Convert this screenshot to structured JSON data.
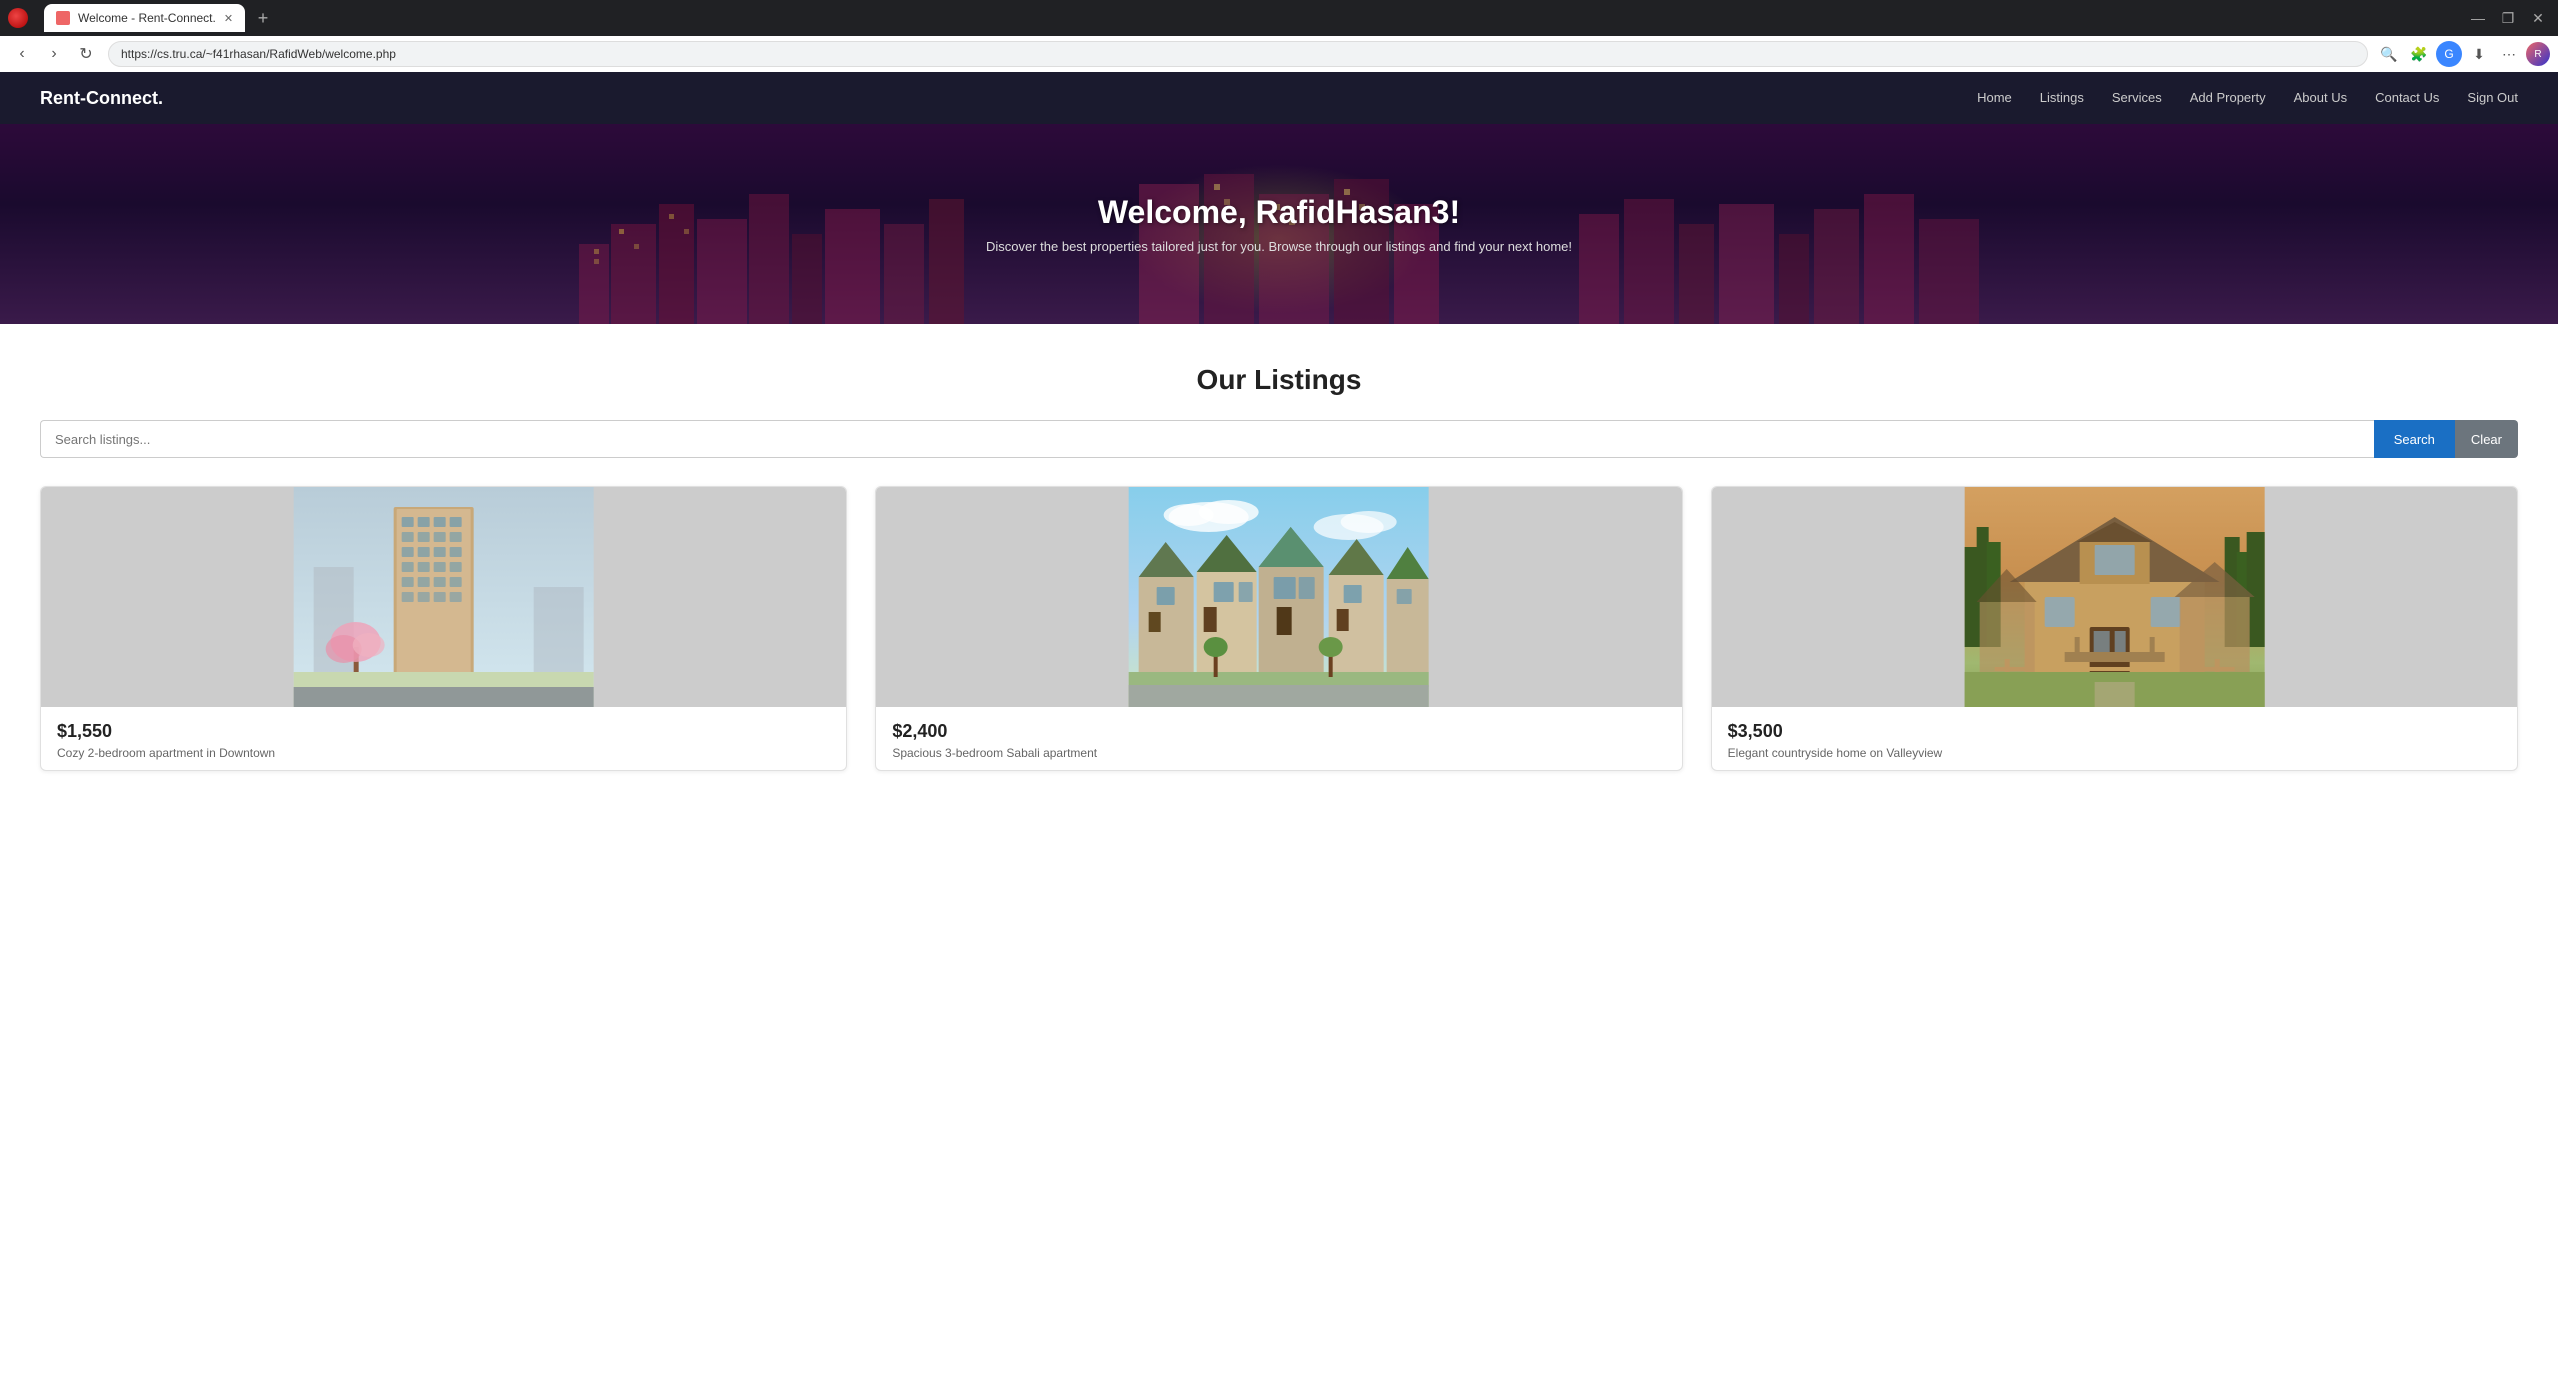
{
  "browser": {
    "tab_title": "Welcome - Rent-Connect.",
    "url": "https://cs.tru.ca/~f41rhasan/RafidWeb/welcome.php",
    "new_tab_label": "+"
  },
  "nav": {
    "logo": "Rent-Connect.",
    "links": [
      {
        "label": "Home",
        "href": "#"
      },
      {
        "label": "Listings",
        "href": "#"
      },
      {
        "label": "Services",
        "href": "#"
      },
      {
        "label": "Add Property",
        "href": "#"
      },
      {
        "label": "About Us",
        "href": "#"
      },
      {
        "label": "Contact Us",
        "href": "#"
      },
      {
        "label": "Sign Out",
        "href": "#"
      }
    ]
  },
  "hero": {
    "title": "Welcome, RafidHasan3!",
    "subtitle": "Discover the best properties tailored just for you. Browse through our listings and find your next home!"
  },
  "listings": {
    "section_title": "Our Listings",
    "search_placeholder": "Search listings...",
    "search_btn_label": "Search",
    "clear_btn_label": "Clear",
    "cards": [
      {
        "price": "$1,550",
        "description": "Cozy 2-bedroom apartment in Downtown",
        "image_type": "highrise"
      },
      {
        "price": "$2,400",
        "description": "Spacious 3-bedroom Sabali apartment",
        "image_type": "townhome"
      },
      {
        "price": "$3,500",
        "description": "Elegant countryside home on Valleyview",
        "image_type": "suburban"
      }
    ]
  }
}
